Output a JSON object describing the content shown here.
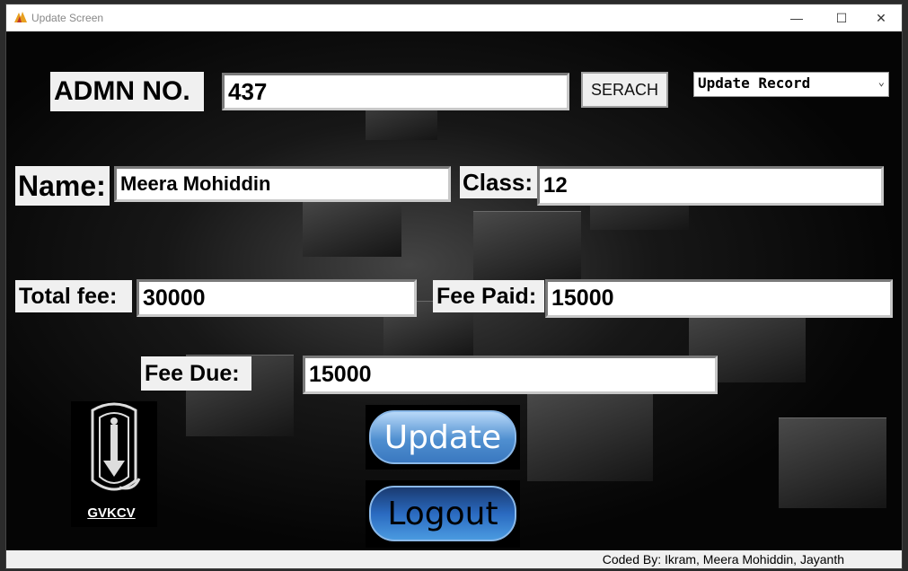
{
  "window": {
    "title": "Update Screen"
  },
  "controls": {
    "minimize": "—",
    "maximize": "☐",
    "close": "✕"
  },
  "form": {
    "admn_label": "ADMN NO.",
    "admn_value": "437",
    "search_label": "SERACH",
    "mode_select": "Update Record",
    "name_label": "Name:",
    "name_value": "Meera Mohiddin",
    "class_label": "Class:",
    "class_value": "12",
    "total_fee_label": "Total fee:",
    "total_fee_value": "30000",
    "fee_paid_label": "Fee Paid:",
    "fee_paid_value": "15000",
    "fee_due_label": "Fee Due:",
    "fee_due_value": "15000"
  },
  "actions": {
    "update_label": "Update",
    "logout_label": "Logout"
  },
  "logo": {
    "caption": "GVKCV",
    "icon": "school-emblem-icon"
  },
  "footer": {
    "credit": "Coded By: Ikram, Meera Mohiddin, Jayanth"
  }
}
